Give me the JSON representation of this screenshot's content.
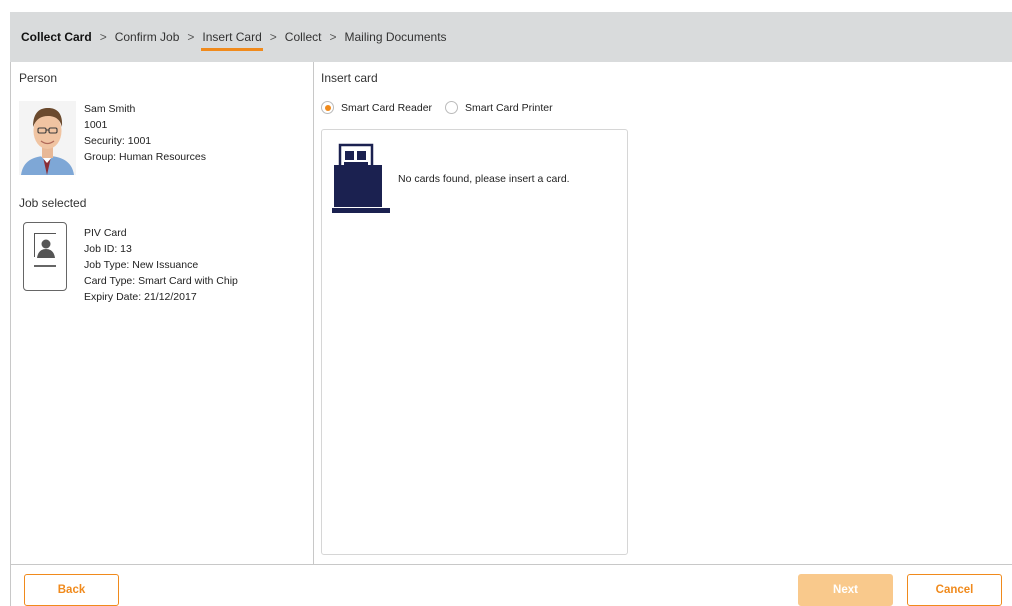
{
  "breadcrumb": {
    "steps": [
      {
        "label": "Collect Card"
      },
      {
        "label": "Confirm Job"
      },
      {
        "label": "Insert Card"
      },
      {
        "label": "Collect"
      },
      {
        "label": "Mailing Documents"
      }
    ],
    "separator": ">",
    "active_index": 2
  },
  "person": {
    "section_label": "Person",
    "name": "Sam Smith",
    "id": "1001",
    "security": "Security: 1001",
    "group": "Group: Human Resources"
  },
  "job": {
    "section_label": "Job selected",
    "card_name": "PIV Card",
    "job_id": "Job ID: 13",
    "job_type": "Job Type: New Issuance",
    "card_type": "Card Type: Smart Card with Chip",
    "expiry": "Expiry Date: 21/12/2017"
  },
  "insert": {
    "section_label": "Insert card",
    "options": [
      {
        "label": "Smart Card Reader",
        "checked": true
      },
      {
        "label": "Smart Card Printer",
        "checked": false
      }
    ],
    "message": "No cards found, please insert a card."
  },
  "footer": {
    "back_label": "Back",
    "next_label": "Next",
    "cancel_label": "Cancel"
  },
  "colors": {
    "accent": "#f08a1c",
    "accent_disabled": "#f9c98c",
    "header_bg": "#d9dbdc",
    "icon_navy": "#1b2150"
  },
  "icons": [
    "person-photo",
    "card-icon",
    "card-reader-icon"
  ]
}
